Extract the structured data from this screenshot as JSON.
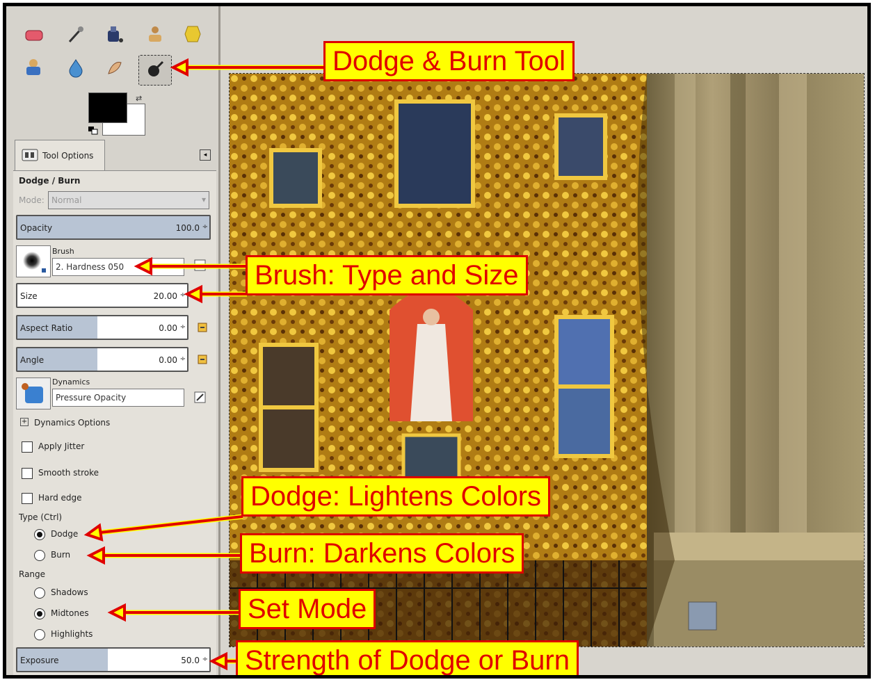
{
  "toolbox": {
    "tools": [
      {
        "name": "eraser-tool",
        "icon": "eraser-icon"
      },
      {
        "name": "airbrush-tool",
        "icon": "airbrush-icon"
      },
      {
        "name": "ink-tool",
        "icon": "ink-icon"
      },
      {
        "name": "clone-tool",
        "icon": "clone-icon"
      },
      {
        "name": "heal-tool",
        "icon": "heal-icon"
      },
      {
        "name": "perspective-clone-tool",
        "icon": "perspective-clone-icon"
      },
      {
        "name": "blur-sharpen-tool",
        "icon": "blur-icon"
      },
      {
        "name": "smudge-tool",
        "icon": "smudge-icon"
      },
      {
        "name": "dodge-burn-tool",
        "icon": "dodge-burn-icon"
      }
    ],
    "colors": {
      "foreground": "#000000",
      "background": "#ffffff"
    }
  },
  "tool_options": {
    "tab_label": "Tool Options",
    "title": "Dodge / Burn",
    "mode_label": "Mode:",
    "mode_value": "Normal",
    "opacity": {
      "label": "Opacity",
      "value": "100.0",
      "fraction": 1.0
    },
    "brush_label": "Brush",
    "brush_value": "2. Hardness 050",
    "size": {
      "label": "Size",
      "value": "20.00",
      "fraction": 0.0
    },
    "aspect_ratio": {
      "label": "Aspect Ratio",
      "value": "0.00",
      "fraction": 0.5
    },
    "angle": {
      "label": "Angle",
      "value": "0.00",
      "fraction": 0.5
    },
    "dynamics_label": "Dynamics",
    "dynamics_value": "Pressure Opacity",
    "dynamics_options": "Dynamics Options",
    "apply_jitter": "Apply Jitter",
    "smooth_stroke": "Smooth stroke",
    "hard_edge": "Hard edge",
    "type_label": "Type  (Ctrl)",
    "type_dodge": "Dodge",
    "type_burn": "Burn",
    "range_label": "Range",
    "range_shadows": "Shadows",
    "range_midtones": "Midtones",
    "range_highlights": "Highlights",
    "exposure": {
      "label": "Exposure",
      "value": "50.0",
      "fraction": 0.5
    }
  },
  "callouts": {
    "dodge_burn_tool": "Dodge & Burn Tool",
    "brush": "Brush: Type and Size",
    "dodge": "Dodge: Lightens Colors",
    "burn": "Burn: Darkens Colors",
    "set_mode": "Set Mode",
    "strength": "Strength of Dodge or Burn"
  },
  "colors": {
    "callout_bg": "#ffff00",
    "callout_text": "#e00000",
    "callout_border": "#dd0000"
  }
}
